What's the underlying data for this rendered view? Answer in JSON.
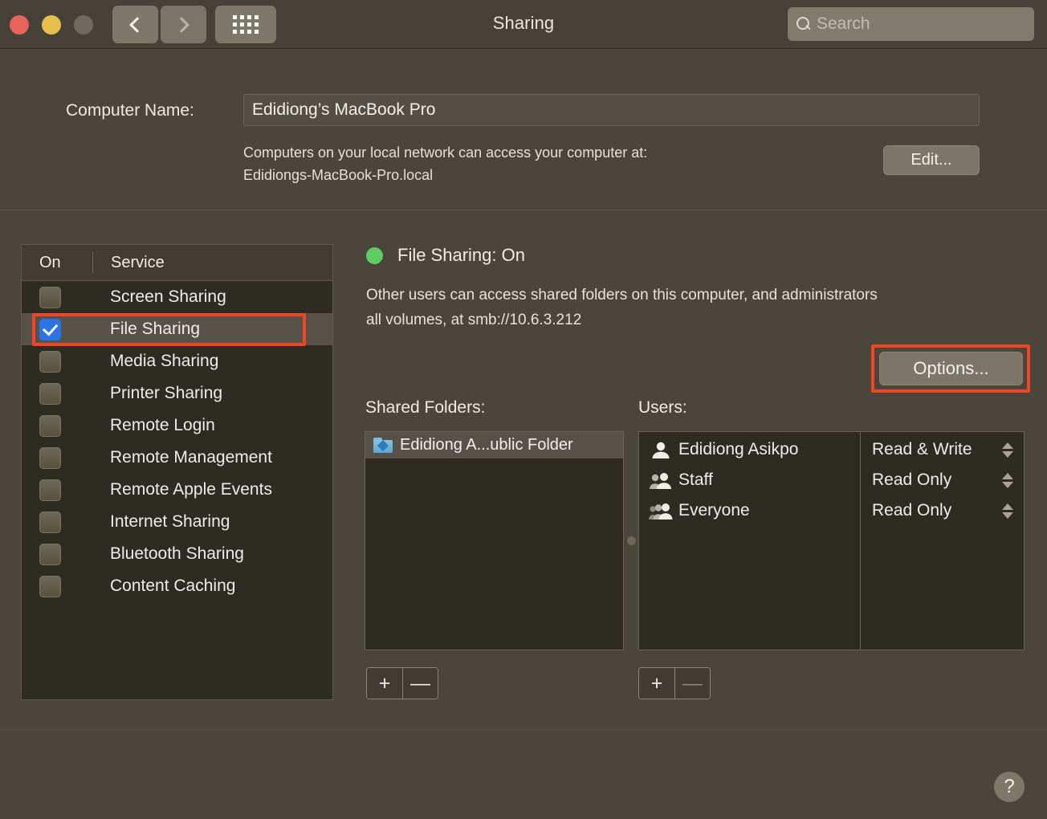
{
  "window": {
    "title": "Sharing",
    "traffic_lights": [
      "close",
      "minimize",
      "zoom"
    ]
  },
  "toolbar": {
    "back_icon": "chevron-left-icon",
    "forward_icon": "chevron-right-icon",
    "grid_icon": "grid-view-icon",
    "search": {
      "placeholder": "Search",
      "value": "",
      "icon": "search-icon"
    }
  },
  "computer_name": {
    "label": "Computer Name:",
    "value": "Edidiong’s MacBook Pro",
    "placeholder": "Computer Name",
    "description_line1": "Computers on your local network can access your computer at:",
    "description_line2": "Edidiongs-MacBook-Pro.local",
    "edit_label": "Edit..."
  },
  "services_table": {
    "columns": [
      "On",
      "Service"
    ],
    "rows": [
      {
        "label": "Screen Sharing",
        "on": false,
        "selected": false
      },
      {
        "label": "File Sharing",
        "on": true,
        "selected": true,
        "highlighted": true
      },
      {
        "label": "Media Sharing",
        "on": false,
        "selected": false
      },
      {
        "label": "Printer Sharing",
        "on": false,
        "selected": false
      },
      {
        "label": "Remote Login",
        "on": false,
        "selected": false
      },
      {
        "label": "Remote Management",
        "on": false,
        "selected": false
      },
      {
        "label": "Remote Apple Events",
        "on": false,
        "selected": false
      },
      {
        "label": "Internet Sharing",
        "on": false,
        "selected": false
      },
      {
        "label": "Bluetooth Sharing",
        "on": false,
        "selected": false
      },
      {
        "label": "Content Caching",
        "on": false,
        "selected": false
      }
    ]
  },
  "detail": {
    "status_title": "File Sharing: On",
    "status_dot_color": "#5ecb63",
    "description_line1": "Other users can access shared folders on this computer, and administrators",
    "description_line2": "all volumes, at smb://10.6.3.212",
    "options_label": "Options...",
    "shared_folders_label": "Shared Folders:",
    "users_label": "Users:",
    "shared_folders": [
      {
        "name": "Edidiong A...ublic Folder",
        "icon": "public-folder-icon",
        "selected": true
      }
    ],
    "users": [
      {
        "name": "Edidiong Asikpo",
        "icon": "single-user-icon",
        "permission": "Read & Write"
      },
      {
        "name": "Staff",
        "icon": "group-user-icon",
        "permission": "Read Only"
      },
      {
        "name": "Everyone",
        "icon": "everyone-user-icon",
        "permission": "Read Only"
      }
    ],
    "folders_add_label": "+",
    "folders_remove_label": "—",
    "users_add_label": "+",
    "users_remove_label": "—"
  },
  "help": {
    "label": "?"
  },
  "annotations": {
    "highlight_color": "#f2462a",
    "highlighted_items": [
      "File Sharing",
      "Options..."
    ]
  }
}
